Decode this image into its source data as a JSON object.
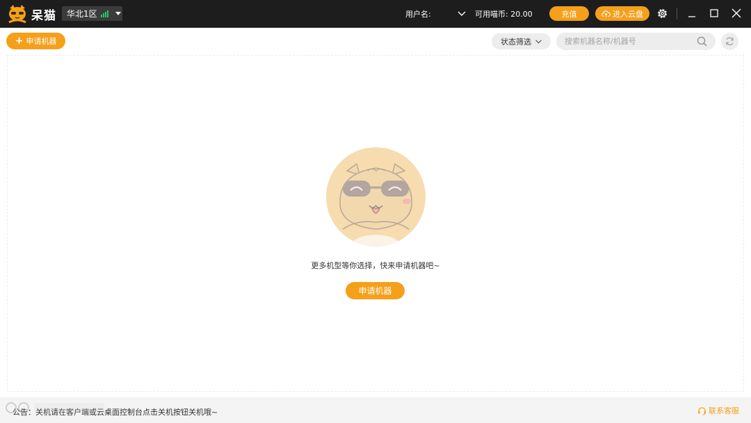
{
  "titlebar": {
    "app_name": "呆猫",
    "region": "华北1区",
    "user_label": "用户名:",
    "coin_label": "可用喵币: 20.00",
    "recharge_button": "充值",
    "cloud_button": "进入云盘"
  },
  "toolbar": {
    "apply_button": "申请机器",
    "status_filter": "状态筛选",
    "search_placeholder": "搜索机器名称/机器号"
  },
  "main": {
    "empty_message": "更多机型等你选择，快来申请机器吧~",
    "apply_button": "申请机器"
  },
  "footer": {
    "notice": "公告：关机请在客户端或云桌面控制台点击关机按钮关机哦~",
    "support_link": "联系客服"
  },
  "colors": {
    "accent": "#f5a01a",
    "titlebar_bg": "#1d1d1d",
    "signal": "#29c36a"
  },
  "icons": [
    "cat-logo-icon",
    "signal-icon",
    "caret-down-icon",
    "chevron-down-icon",
    "cloud-upload-icon",
    "gear-icon",
    "minimize-icon",
    "maximize-icon",
    "close-icon",
    "plus-icon",
    "search-icon",
    "refresh-icon",
    "headset-icon"
  ]
}
